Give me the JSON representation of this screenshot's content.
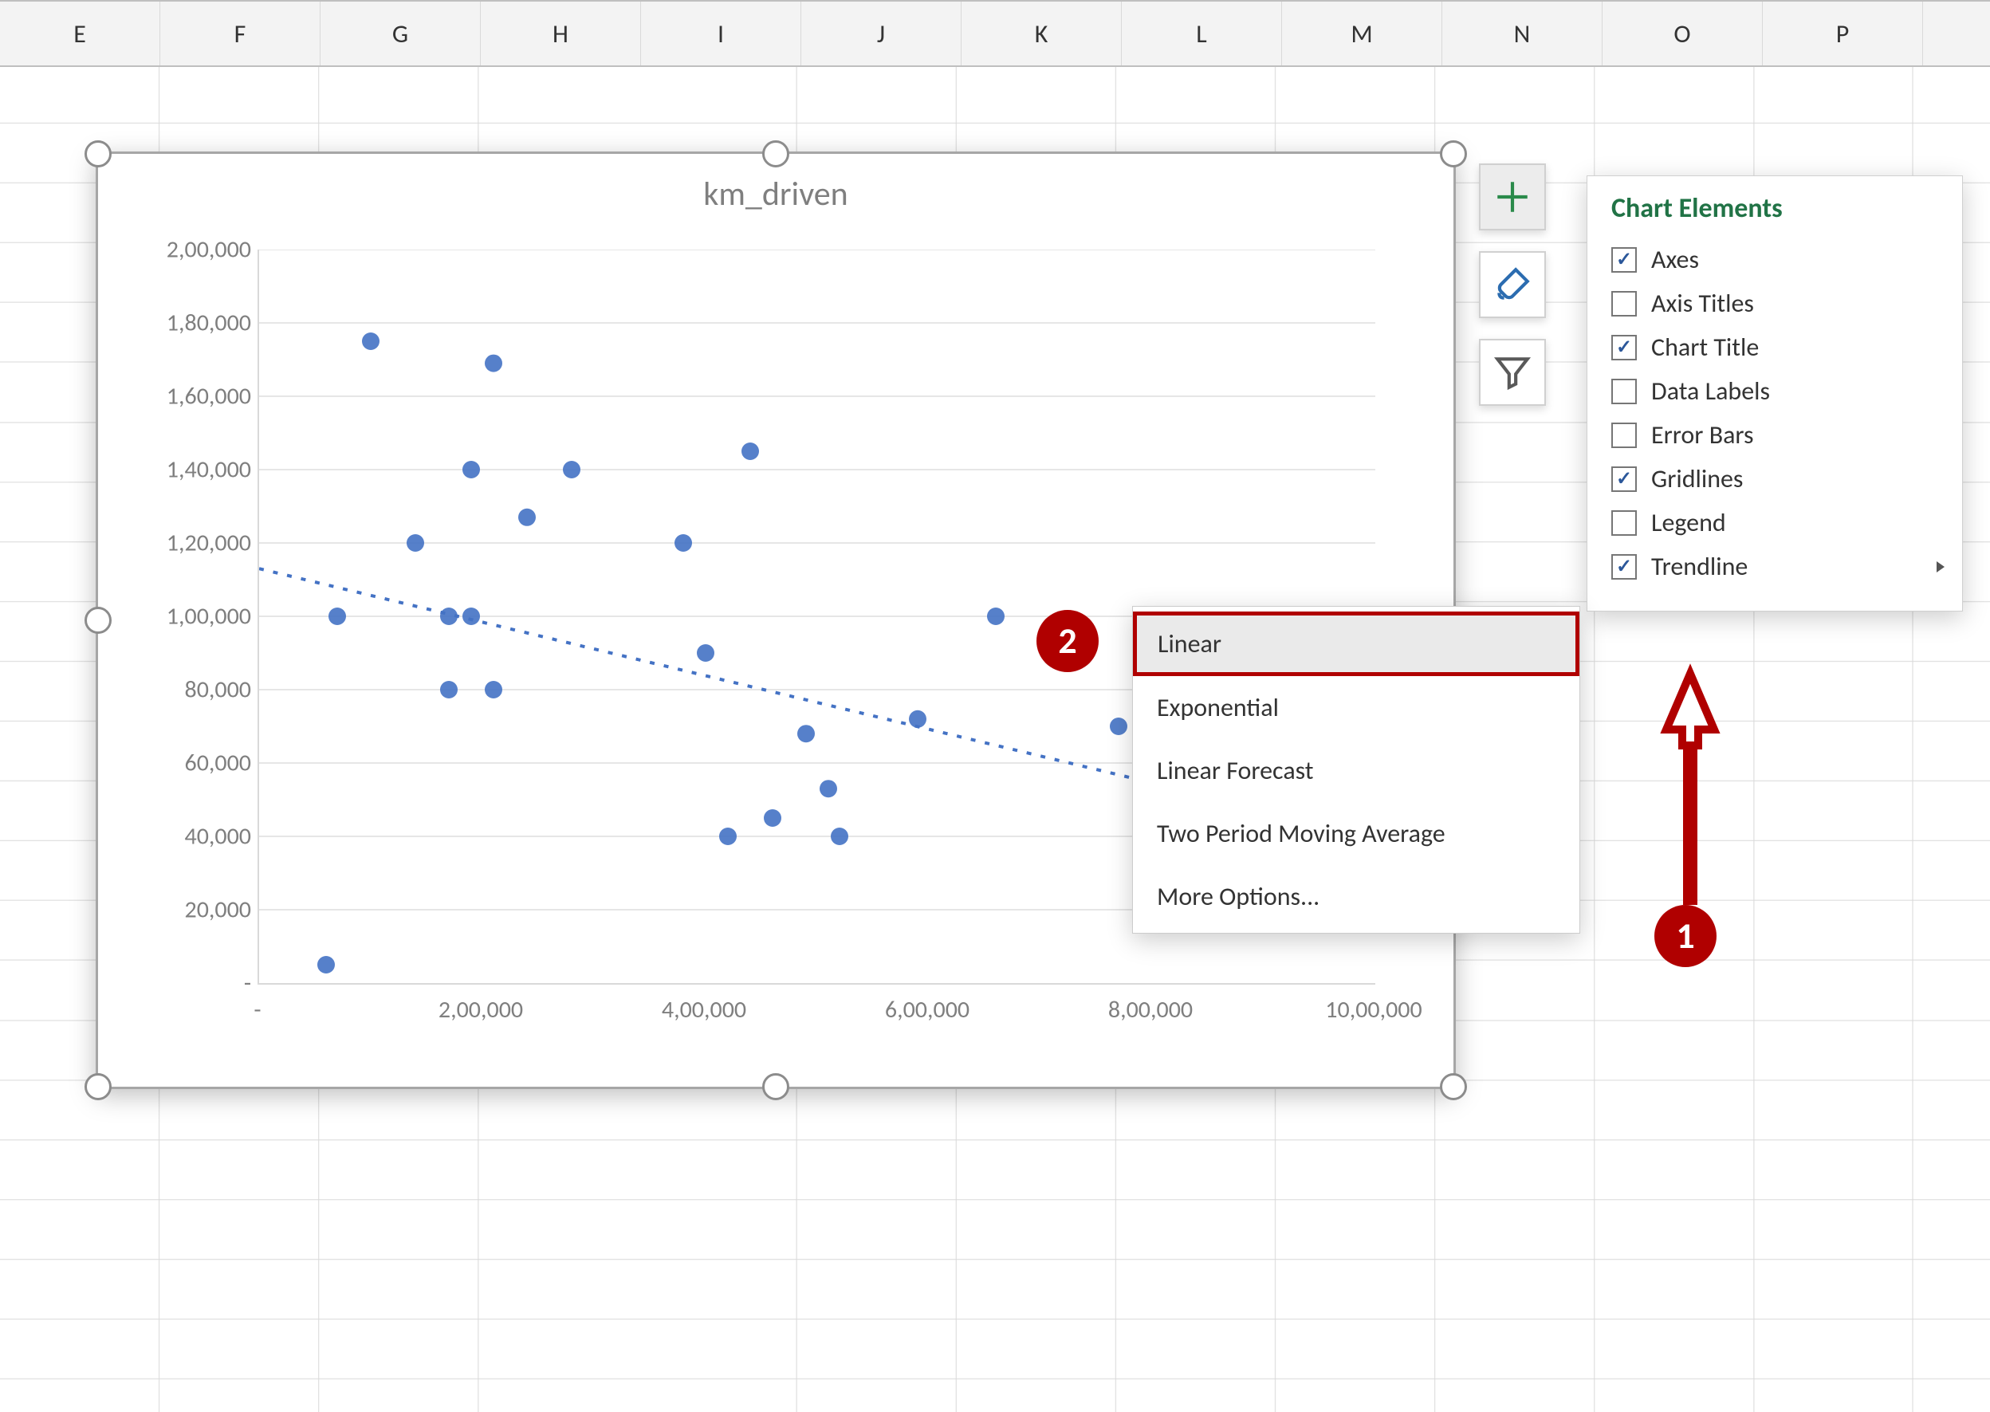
{
  "columns": [
    "E",
    "F",
    "G",
    "H",
    "I",
    "J",
    "K",
    "L",
    "M",
    "N",
    "O",
    "P"
  ],
  "chart_title": "km_driven",
  "y_tick_labels": [
    "-",
    "20,000",
    "40,000",
    "60,000",
    "80,000",
    "1,00,000",
    "1,20,000",
    "1,40,000",
    "1,60,000",
    "1,80,000",
    "2,00,000"
  ],
  "x_tick_labels": [
    "-",
    "2,00,000",
    "4,00,000",
    "6,00,000",
    "8,00,000",
    "10,00,000"
  ],
  "side_buttons": {
    "plus": "plus-icon",
    "brush": "brush-icon",
    "funnel": "funnel-icon"
  },
  "flyout_title": "Chart Elements",
  "flyout_items": [
    {
      "label": "Axes",
      "checked": true
    },
    {
      "label": "Axis Titles",
      "checked": false
    },
    {
      "label": "Chart Title",
      "checked": true
    },
    {
      "label": "Data Labels",
      "checked": false
    },
    {
      "label": "Error Bars",
      "checked": false
    },
    {
      "label": "Gridlines",
      "checked": true
    },
    {
      "label": "Legend",
      "checked": false
    },
    {
      "label": "Trendline",
      "checked": true,
      "expand": true
    }
  ],
  "submenu": {
    "highlight_index": 0,
    "items": [
      "Linear",
      "Exponential",
      "Linear Forecast",
      "Two Period Moving Average",
      "More Options..."
    ]
  },
  "callouts": {
    "one": "1",
    "two": "2"
  },
  "chart_data": {
    "type": "scatter",
    "title": "km_driven",
    "xlabel": "",
    "ylabel": "",
    "xlim": [
      0,
      1000000
    ],
    "ylim": [
      0,
      200000
    ],
    "grid": true,
    "trendline": {
      "type": "linear",
      "y_at_x0": 113000,
      "y_at_xmax": 40000
    },
    "series": [
      {
        "name": "km_driven",
        "points": [
          {
            "x": 60000,
            "y": 5000
          },
          {
            "x": 70000,
            "y": 100000
          },
          {
            "x": 100000,
            "y": 175000
          },
          {
            "x": 140000,
            "y": 120000
          },
          {
            "x": 170000,
            "y": 100000
          },
          {
            "x": 170000,
            "y": 80000
          },
          {
            "x": 190000,
            "y": 140000
          },
          {
            "x": 190000,
            "y": 100000
          },
          {
            "x": 210000,
            "y": 80000
          },
          {
            "x": 210000,
            "y": 169000
          },
          {
            "x": 240000,
            "y": 127000
          },
          {
            "x": 280000,
            "y": 140000
          },
          {
            "x": 380000,
            "y": 120000
          },
          {
            "x": 400000,
            "y": 90000
          },
          {
            "x": 420000,
            "y": 40000
          },
          {
            "x": 440000,
            "y": 145000
          },
          {
            "x": 460000,
            "y": 45000
          },
          {
            "x": 490000,
            "y": 68000
          },
          {
            "x": 510000,
            "y": 53000
          },
          {
            "x": 520000,
            "y": 40000
          },
          {
            "x": 590000,
            "y": 72000
          },
          {
            "x": 660000,
            "y": 100000
          },
          {
            "x": 770000,
            "y": 70000
          }
        ]
      }
    ]
  }
}
